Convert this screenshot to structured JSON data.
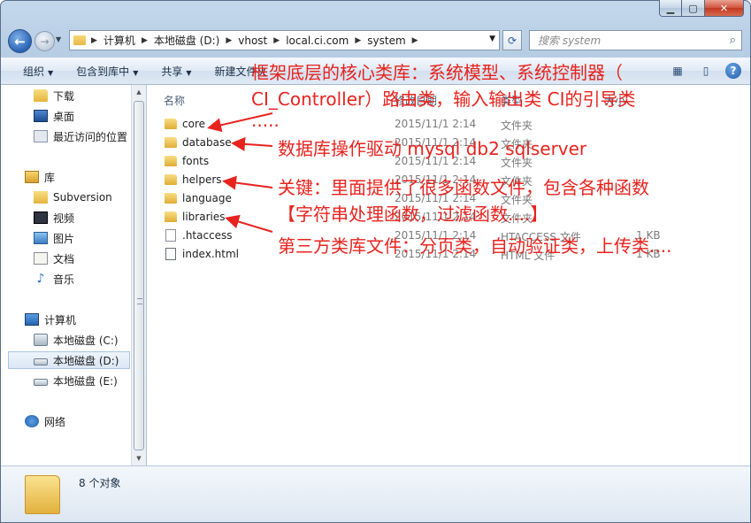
{
  "window": {
    "controls": {
      "minimize": "▁",
      "maximize": "▢",
      "close": "✕"
    }
  },
  "address_bar": {
    "crumbs": [
      "计算机",
      "本地磁盘 (D:)",
      "vhost",
      "local.ci.com",
      "system"
    ],
    "search_placeholder": "搜索 system"
  },
  "toolbar": {
    "organize": "组织",
    "include_in_library": "包含到库中",
    "share": "共享",
    "new_folder": "新建文件夹"
  },
  "nav": {
    "favorites": [
      "下载",
      "桌面",
      "最近访问的位置"
    ],
    "libraries_header": "库",
    "libraries": [
      "Subversion",
      "视频",
      "图片",
      "文档",
      "音乐"
    ],
    "computer_header": "计算机",
    "drives": [
      "本地磁盘 (C:)",
      "本地磁盘 (D:)",
      "本地磁盘 (E:)"
    ],
    "network": "网络",
    "selected": "本地磁盘 (D:)"
  },
  "columns": {
    "name": "名称",
    "modified": "修改日期",
    "type": "类型",
    "size": "大小"
  },
  "files": [
    {
      "name": "core",
      "modified": "2015/11/1 2:14",
      "type": "文件夹",
      "size": "",
      "kind": "folder"
    },
    {
      "name": "database",
      "modified": "2015/11/1 2:14",
      "type": "文件夹",
      "size": "",
      "kind": "folder"
    },
    {
      "name": "fonts",
      "modified": "2015/11/1 2:14",
      "type": "文件夹",
      "size": "",
      "kind": "folder"
    },
    {
      "name": "helpers",
      "modified": "2015/11/1 2:14",
      "type": "文件夹",
      "size": "",
      "kind": "folder"
    },
    {
      "name": "language",
      "modified": "2015/11/1 2:14",
      "type": "文件夹",
      "size": "",
      "kind": "folder"
    },
    {
      "name": "libraries",
      "modified": "2015/11/1 2:14",
      "type": "文件夹",
      "size": "",
      "kind": "folder"
    },
    {
      "name": ".htaccess",
      "modified": "2015/11/1 2:14",
      "type": "HTACCESS 文件",
      "size": "1 KB",
      "kind": "file"
    },
    {
      "name": "index.html",
      "modified": "2015/11/1 2:14",
      "type": "HTML 文件",
      "size": "1 KB",
      "kind": "html"
    }
  ],
  "status": {
    "item_count": "8 个对象"
  },
  "annotations": {
    "core_line1": "框架底层的核心类库：系统模型、系统控制器（",
    "core_line2": "CI_Controller）路由类，输入输出类 CI的引导类",
    "core_line3": ".....",
    "database": "数据库操作驱动 mysql db2 sqlserver",
    "helpers_line1": "关键：里面提供了很多函数文件，包含各种函数",
    "helpers_line2": "【字符串处理函数，过滤函数....】",
    "libraries": "第三方类库文件：分页类，自动验证类，上传类....",
    "color": "#e8231e"
  }
}
